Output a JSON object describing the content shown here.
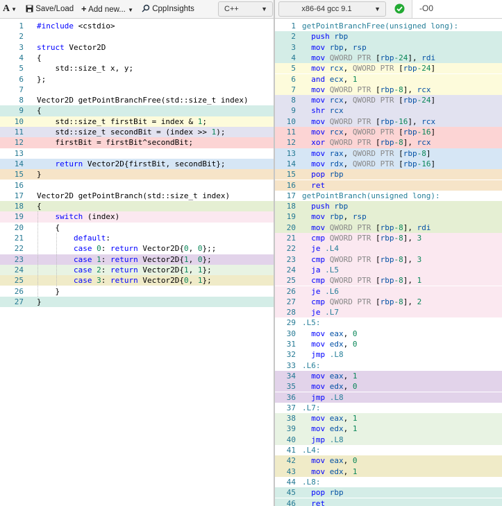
{
  "toolbar_left": {
    "logo": "A",
    "save_load": "Save/Load",
    "add_new": "Add new...",
    "cppinsights": "CppInsights",
    "language": "C++"
  },
  "toolbar_right": {
    "compiler": "x86-64 gcc 9.1",
    "options": "-O0",
    "status": "compile-ok"
  },
  "icons": {
    "logo": "logo-menu-icon",
    "save": "floppy-disk-icon",
    "add": "plus-icon",
    "insights": "insights-icon",
    "status": "check-circle-icon"
  },
  "colors": {
    "teal": "#d4ede7",
    "yellow": "#fdfbdb",
    "lavender": "#e2e2f0",
    "red": "#fcd4d4",
    "blue": "#d6e6f5",
    "orange": "#f6e4c8",
    "lime": "#e5efd3",
    "pink": "#fbe8f0",
    "purple": "#e2d3ea",
    "mint": "#e8f3e3",
    "khaki": "#f0ebc8",
    "success": "#22aa33"
  },
  "source_lines": [
    {
      "n": "1",
      "text": "#include <cstdio>",
      "bg": "none"
    },
    {
      "n": "2",
      "text": "",
      "bg": "none"
    },
    {
      "n": "3",
      "text": "struct Vector2D",
      "bg": "none"
    },
    {
      "n": "4",
      "text": "{",
      "bg": "none"
    },
    {
      "n": "5",
      "text": "    std::size_t x, y;",
      "bg": "none"
    },
    {
      "n": "6",
      "text": "};",
      "bg": "none"
    },
    {
      "n": "7",
      "text": "",
      "bg": "none"
    },
    {
      "n": "8",
      "text": "Vector2D getPointBranchFree(std::size_t index)",
      "bg": "none"
    },
    {
      "n": "9",
      "text": "{",
      "bg": "teal"
    },
    {
      "n": "10",
      "text": "    std::size_t firstBit = index & 1;",
      "bg": "yellow"
    },
    {
      "n": "11",
      "text": "    std::size_t secondBit = (index >> 1);",
      "bg": "lav"
    },
    {
      "n": "12",
      "text": "    firstBit = firstBit^secondBit;",
      "bg": "red"
    },
    {
      "n": "13",
      "text": "",
      "bg": "none"
    },
    {
      "n": "14",
      "text": "    return Vector2D{firstBit, secondBit};",
      "bg": "blue"
    },
    {
      "n": "15",
      "text": "}",
      "bg": "orange"
    },
    {
      "n": "16",
      "text": "",
      "bg": "none"
    },
    {
      "n": "17",
      "text": "Vector2D getPointBranch(std::size_t index)",
      "bg": "none"
    },
    {
      "n": "18",
      "text": "{",
      "bg": "lime"
    },
    {
      "n": "19",
      "text": "    switch (index)",
      "bg": "pink"
    },
    {
      "n": "20",
      "text": "    {",
      "bg": "none"
    },
    {
      "n": "21",
      "text": "        default:",
      "bg": "none"
    },
    {
      "n": "22",
      "text": "        case 0: return Vector2D{0, 0};;",
      "bg": "hatch"
    },
    {
      "n": "23",
      "text": "        case 1: return Vector2D{1, 0};",
      "bg": "purple"
    },
    {
      "n": "24",
      "text": "        case 2: return Vector2D{1, 1};",
      "bg": "mint"
    },
    {
      "n": "25",
      "text": "        case 3: return Vector2D{0, 1};",
      "bg": "khaki"
    },
    {
      "n": "26",
      "text": "    }",
      "bg": "none"
    },
    {
      "n": "27",
      "text": "}",
      "bg": "teal"
    }
  ],
  "asm_lines": [
    {
      "n": "1",
      "text": "getPointBranchFree(unsigned long):",
      "bg": "none"
    },
    {
      "n": "2",
      "text": "  push rbp",
      "bg": "teal"
    },
    {
      "n": "3",
      "text": "  mov rbp, rsp",
      "bg": "teal"
    },
    {
      "n": "4",
      "text": "  mov QWORD PTR [rbp-24], rdi",
      "bg": "teal"
    },
    {
      "n": "5",
      "text": "  mov rcx, QWORD PTR [rbp-24]",
      "bg": "yellow"
    },
    {
      "n": "6",
      "text": "  and ecx, 1",
      "bg": "yellow"
    },
    {
      "n": "7",
      "text": "  mov QWORD PTR [rbp-8], rcx",
      "bg": "yellow"
    },
    {
      "n": "8",
      "text": "  mov rcx, QWORD PTR [rbp-24]",
      "bg": "lav"
    },
    {
      "n": "9",
      "text": "  shr rcx",
      "bg": "lav"
    },
    {
      "n": "10",
      "text": "  mov QWORD PTR [rbp-16], rcx",
      "bg": "lav"
    },
    {
      "n": "11",
      "text": "  mov rcx, QWORD PTR [rbp-16]",
      "bg": "red"
    },
    {
      "n": "12",
      "text": "  xor QWORD PTR [rbp-8], rcx",
      "bg": "red"
    },
    {
      "n": "13",
      "text": "  mov rax, QWORD PTR [rbp-8]",
      "bg": "blue"
    },
    {
      "n": "14",
      "text": "  mov rdx, QWORD PTR [rbp-16]",
      "bg": "blue"
    },
    {
      "n": "15",
      "text": "  pop rbp",
      "bg": "orange"
    },
    {
      "n": "16",
      "text": "  ret",
      "bg": "orange"
    },
    {
      "n": "17",
      "text": "getPointBranch(unsigned long):",
      "bg": "none"
    },
    {
      "n": "18",
      "text": "  push rbp",
      "bg": "lime"
    },
    {
      "n": "19",
      "text": "  mov rbp, rsp",
      "bg": "lime"
    },
    {
      "n": "20",
      "text": "  mov QWORD PTR [rbp-8], rdi",
      "bg": "lime"
    },
    {
      "n": "21",
      "text": "  cmp QWORD PTR [rbp-8], 3",
      "bg": "pink"
    },
    {
      "n": "22",
      "text": "  je .L4",
      "bg": "pink"
    },
    {
      "n": "23",
      "text": "  cmp QWORD PTR [rbp-8], 3",
      "bg": "pink"
    },
    {
      "n": "24",
      "text": "  ja .L5",
      "bg": "pink"
    },
    {
      "n": "25",
      "text": "  cmp QWORD PTR [rbp-8], 1",
      "bg": "pink"
    },
    {
      "n": "26",
      "text": "  je .L6",
      "bg": "pink"
    },
    {
      "n": "27",
      "text": "  cmp QWORD PTR [rbp-8], 2",
      "bg": "pink"
    },
    {
      "n": "28",
      "text": "  je .L7",
      "bg": "pink"
    },
    {
      "n": "29",
      "text": ".L5:",
      "bg": "none"
    },
    {
      "n": "30",
      "text": "  mov eax, 0",
      "bg": "hatch"
    },
    {
      "n": "31",
      "text": "  mov edx, 0",
      "bg": "hatch"
    },
    {
      "n": "32",
      "text": "  jmp .L8",
      "bg": "hatch"
    },
    {
      "n": "33",
      "text": ".L6:",
      "bg": "none"
    },
    {
      "n": "34",
      "text": "  mov eax, 1",
      "bg": "purple"
    },
    {
      "n": "35",
      "text": "  mov edx, 0",
      "bg": "purple"
    },
    {
      "n": "36",
      "text": "  jmp .L8",
      "bg": "purple"
    },
    {
      "n": "37",
      "text": ".L7:",
      "bg": "none"
    },
    {
      "n": "38",
      "text": "  mov eax, 1",
      "bg": "mint"
    },
    {
      "n": "39",
      "text": "  mov edx, 1",
      "bg": "mint"
    },
    {
      "n": "40",
      "text": "  jmp .L8",
      "bg": "mint"
    },
    {
      "n": "41",
      "text": ".L4:",
      "bg": "none"
    },
    {
      "n": "42",
      "text": "  mov eax, 0",
      "bg": "khaki"
    },
    {
      "n": "43",
      "text": "  mov edx, 1",
      "bg": "khaki"
    },
    {
      "n": "44",
      "text": ".L8:",
      "bg": "none"
    },
    {
      "n": "45",
      "text": "  pop rbp",
      "bg": "teal"
    },
    {
      "n": "46",
      "text": "  ret",
      "bg": "teal"
    }
  ]
}
